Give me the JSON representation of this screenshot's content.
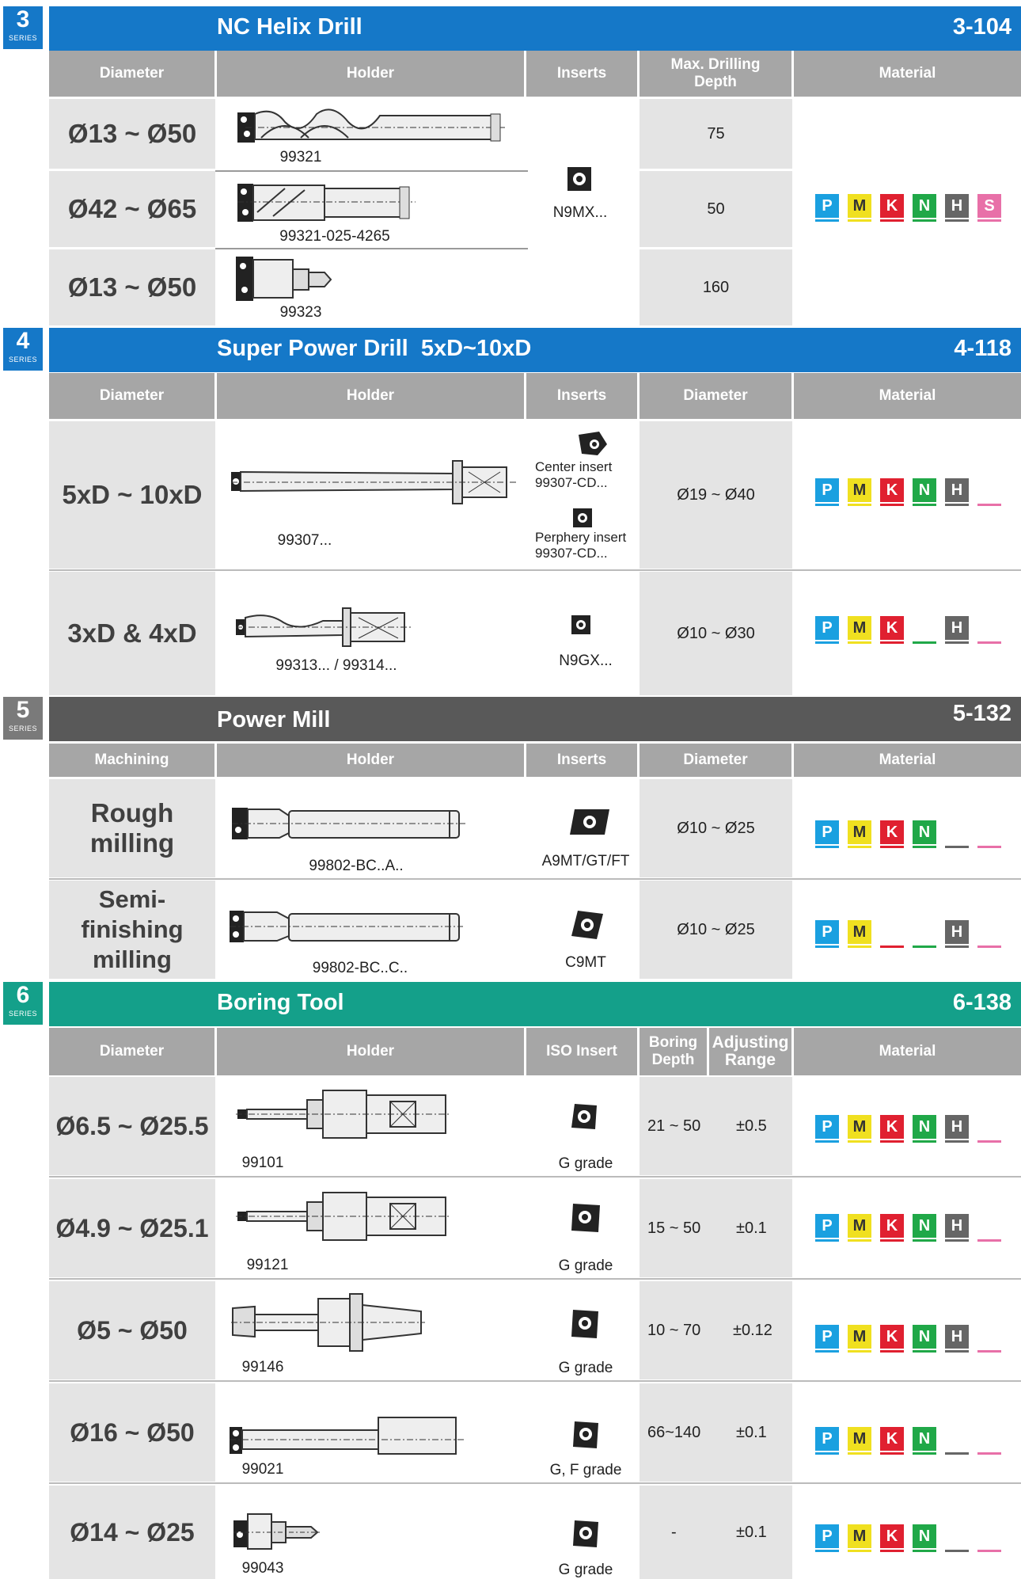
{
  "sections": [
    {
      "series_number": "3",
      "series_label": "SERIES",
      "title": "NC Helix Drill",
      "page": "3-104",
      "headers": {
        "c1": "Diameter",
        "c2": "Holder",
        "c3": "Inserts",
        "c4": "Max. Drilling Depth",
        "c5": "Material"
      },
      "rows": [
        {
          "diameter": "Ø13 ~ Ø50",
          "holder": "99321",
          "depth": "75"
        },
        {
          "diameter": "Ø42 ~ Ø65",
          "holder": "99321-025-4265",
          "depth": "50"
        },
        {
          "diameter": "Ø13 ~ Ø50",
          "holder": "99323",
          "depth": "160"
        }
      ],
      "insert": "N9MX..."
    },
    {
      "series_number": "4",
      "series_label": "SERIES",
      "title": "Super Power Drill  5xD~10xD",
      "page": "4-118",
      "headers": {
        "c1": "Diameter",
        "c2": "Holder",
        "c3": "Inserts",
        "c4": "Diameter",
        "c5": "Material"
      },
      "rows": [
        {
          "diameter": "5xD ~ 10xD",
          "holder": "99307...",
          "insert_center_label": "Center insert",
          "insert_center_code": "99307-CD...",
          "insert_periphery_label": "Perphery insert",
          "insert_periphery_code": "99307-CD...",
          "range": "Ø19 ~ Ø40"
        },
        {
          "diameter": "3xD & 4xD",
          "holder": "99313... / 99314...",
          "insert": "N9GX...",
          "range": "Ø10 ~ Ø30"
        }
      ]
    },
    {
      "series_number": "5",
      "series_label": "SERIES",
      "title": "Power Mill",
      "page": "5-132",
      "headers": {
        "c1": "Machining",
        "c2": "Holder",
        "c3": "Inserts",
        "c4": "Diameter",
        "c5": "Material"
      },
      "rows": [
        {
          "machining_1": "Rough",
          "machining_2": "milling",
          "holder": "99802-BC..A..",
          "insert": "A9MT/GT/FT",
          "range": "Ø10 ~ Ø25"
        },
        {
          "machining_1": "Semi-finishing",
          "machining_2": "milling",
          "holder": "99802-BC..C..",
          "insert": "C9MT",
          "range": "Ø10 ~ Ø25"
        }
      ]
    },
    {
      "series_number": "6",
      "series_label": "SERIES",
      "title": "Boring Tool",
      "page": "6-138",
      "headers": {
        "c1": "Diameter",
        "c2": "Holder",
        "c3": "ISO Insert",
        "c4a": "Boring Depth",
        "c4b": "Adjusting Range",
        "c5": "Material"
      },
      "rows": [
        {
          "diameter": "Ø6.5 ~ Ø25.5",
          "holder": "99101",
          "insert": "G grade",
          "depth": "21 ~ 50",
          "adjust": "±0.5"
        },
        {
          "diameter": "Ø4.9 ~ Ø25.1",
          "holder": "99121",
          "insert": "G grade",
          "depth": "15 ~ 50",
          "adjust": "±0.1"
        },
        {
          "diameter": "Ø5 ~ Ø50",
          "holder": "99146",
          "insert": "G grade",
          "depth": "10 ~ 70",
          "adjust": "±0.12"
        },
        {
          "diameter": "Ø16 ~ Ø50",
          "holder": "99021",
          "insert": "G, F grade",
          "depth": "66~140",
          "adjust": "±0.1"
        },
        {
          "diameter": "Ø14 ~ Ø25",
          "holder": "99043",
          "insert": "G grade",
          "depth": "-",
          "adjust": "±0.1"
        }
      ]
    }
  ],
  "material_letters": {
    "P": "P",
    "M": "M",
    "K": "K",
    "N": "N",
    "H": "H",
    "S": "S"
  },
  "colors": {
    "blue": "#1578c8",
    "dark": "#595959",
    "teal": "#14a08a",
    "header": "#a6a6a6",
    "P": "#1aa0e0",
    "M": "#f0e020",
    "K": "#e02030",
    "N": "#20a848",
    "H": "#666666",
    "S": "#e870a8"
  }
}
